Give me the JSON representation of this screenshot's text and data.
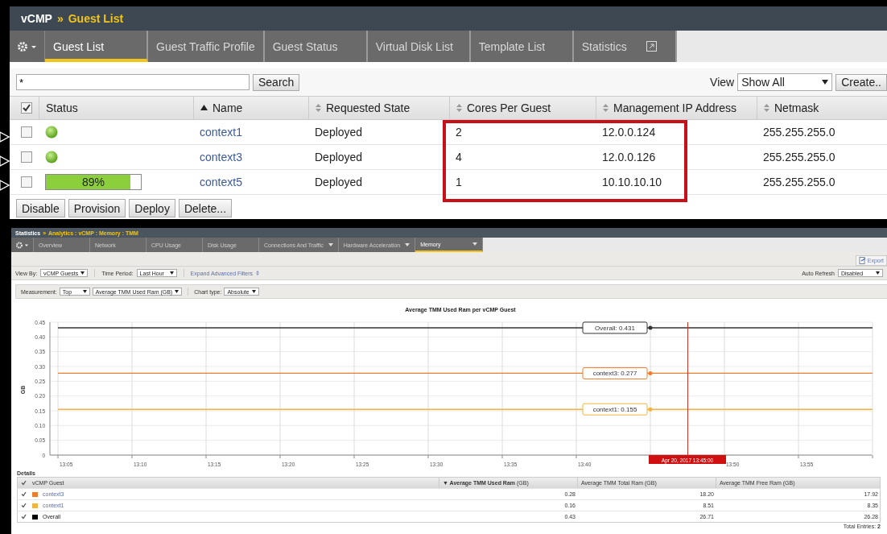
{
  "top": {
    "breadcrumb": {
      "root": "vCMP",
      "separator": "»",
      "current": "Guest List"
    },
    "tabs": [
      {
        "label": "Guest List",
        "selected": true,
        "external": false
      },
      {
        "label": "Guest Traffic Profile",
        "selected": false,
        "external": false
      },
      {
        "label": "Guest Status",
        "selected": false,
        "external": false
      },
      {
        "label": "Virtual Disk List",
        "selected": false,
        "external": false
      },
      {
        "label": "Template List",
        "selected": false,
        "external": false
      },
      {
        "label": "Statistics",
        "selected": false,
        "external": true
      }
    ],
    "filter": {
      "value": "*",
      "search_button": "Search",
      "view_label": "View",
      "view_value": "Show All",
      "create_button": "Create.."
    },
    "table": {
      "all_checked": true,
      "columns": [
        {
          "label": "Status",
          "sortable": false
        },
        {
          "label": "Name",
          "sorted_asc": true,
          "sortable": true
        },
        {
          "label": "Requested State",
          "sorted_asc": false,
          "sortable": true
        },
        {
          "label": "Cores Per Guest",
          "sorted_asc": false,
          "sortable": true
        },
        {
          "label": "Management IP Address",
          "sorted_asc": false,
          "sortable": true
        },
        {
          "label": "Netmask",
          "sorted_asc": false,
          "sortable": true
        }
      ],
      "rows": [
        {
          "checked": false,
          "status": {
            "kind": "dot"
          },
          "name": "context1",
          "state": "Deployed",
          "cores": "2",
          "ip": "12.0.0.124",
          "netmask": "255.255.255.0"
        },
        {
          "checked": false,
          "status": {
            "kind": "dot"
          },
          "name": "context3",
          "state": "Deployed",
          "cores": "4",
          "ip": "12.0.0.126",
          "netmask": "255.255.255.0"
        },
        {
          "checked": false,
          "status": {
            "kind": "progress",
            "level": 0.89,
            "text": "89%"
          },
          "name": "context5",
          "state": "Deployed",
          "cores": "1",
          "ip": "10.10.10.10",
          "netmask": "255.255.255.0"
        }
      ]
    },
    "buttons": [
      "Disable",
      "Provision",
      "Deploy",
      "Delete..."
    ]
  },
  "bottom": {
    "breadcrumb": {
      "root": "Statistics",
      "separator": "»",
      "current": "Analytics : vCMP : Memory : TMM"
    },
    "tabs": [
      {
        "label": "Overview",
        "selected": false,
        "dropdown": false
      },
      {
        "label": "Network",
        "selected": false,
        "dropdown": false
      },
      {
        "label": "CPU Usage",
        "selected": false,
        "dropdown": false
      },
      {
        "label": "Disk Usage",
        "selected": false,
        "dropdown": false
      },
      {
        "label": "Connections And Traffic",
        "selected": false,
        "dropdown": true
      },
      {
        "label": "Hardware Acceleration",
        "selected": false,
        "dropdown": true
      },
      {
        "label": "Memory",
        "selected": true,
        "dropdown": true
      }
    ],
    "export_button": "Export",
    "filters": {
      "view_by_label": "View By:",
      "view_by": "vCMP Guests",
      "time_period_label": "Time Period:",
      "time_period": "Last Hour",
      "advanced_link": "Expand Advanced Filters",
      "auto_refresh_label": "Auto Refresh",
      "auto_refresh": "Disabled"
    },
    "measurement": {
      "label": "Measurement:",
      "value": "Top",
      "metric": "Average TMM Used Ram (GB)",
      "chart_type_label": "Chart type:",
      "chart_type": "Absolute"
    },
    "chart": {
      "chart_data": {
        "type": "line",
        "title": "Average TMM Used Ram per vCMP Guest",
        "ylabel": "GB",
        "categories": [
          "13:05",
          "13:10",
          "13:15",
          "13:20",
          "13:25",
          "13:30",
          "13:35",
          "13:40",
          null,
          "13:50",
          "13:55",
          null
        ],
        "series": [
          {
            "name": "Overall",
            "color": "#333333",
            "values": [
              0.431,
              0.431,
              0.431,
              0.431,
              0.431,
              0.431,
              0.431,
              0.431,
              0.431,
              0.431,
              0.431,
              0.431
            ]
          },
          {
            "name": "context3",
            "color": "#ee7d2d",
            "values": [
              0.277,
              0.277,
              0.277,
              0.277,
              0.277,
              0.277,
              0.277,
              0.277,
              0.277,
              0.277,
              0.277,
              0.277
            ]
          },
          {
            "name": "context1",
            "color": "#f2b43c",
            "values": [
              0.155,
              0.155,
              0.155,
              0.155,
              0.155,
              0.155,
              0.155,
              0.155,
              0.155,
              0.155,
              0.155,
              0.155
            ]
          }
        ],
        "ylim": [
          0,
          0.45
        ],
        "grid": true,
        "yticks": [
          {
            "value": 0,
            "label": "0"
          },
          {
            "value": 0.05,
            "label": "0.05"
          },
          {
            "value": 0.1,
            "label": "0.10"
          },
          {
            "value": 0.15,
            "label": "0.15"
          },
          {
            "value": 0.2,
            "label": "0.20"
          },
          {
            "value": 0.25,
            "label": "0.25"
          },
          {
            "value": 0.3,
            "label": "0.30"
          },
          {
            "value": 0.35,
            "label": "0.35"
          },
          {
            "value": 0.4,
            "label": "0.40"
          },
          {
            "value": 0.45,
            "label": "0.45"
          }
        ]
      },
      "hover_readings": [
        ": 0.431",
        ": 0.277",
        ": 0.155"
      ],
      "crosshair_label": "Apr 20, 2017 13:45:00"
    },
    "details": {
      "title": "Details",
      "all_checked": true,
      "columns": [
        "vCMP Guest",
        "**▼ Average TMM Used Ram** (GB)",
        "Average TMM Total Ram (GB)",
        "Average TMM Free Ram (GB)"
      ],
      "rows": [
        {
          "checked": true,
          "color": "#ee7d2d",
          "link": true,
          "name": "context3",
          "used": "0.28",
          "total": "18.20",
          "free": "17.92"
        },
        {
          "checked": true,
          "color": "#f2b43c",
          "link": true,
          "name": "context1",
          "used": "0.16",
          "total": "8.51",
          "free": "8.35"
        },
        {
          "checked": true,
          "color": "#000000",
          "link": false,
          "name": "Overall",
          "used": "0.43",
          "total": "26.71",
          "free": "26.28"
        }
      ],
      "footer": "Total Entries: **2**"
    }
  }
}
